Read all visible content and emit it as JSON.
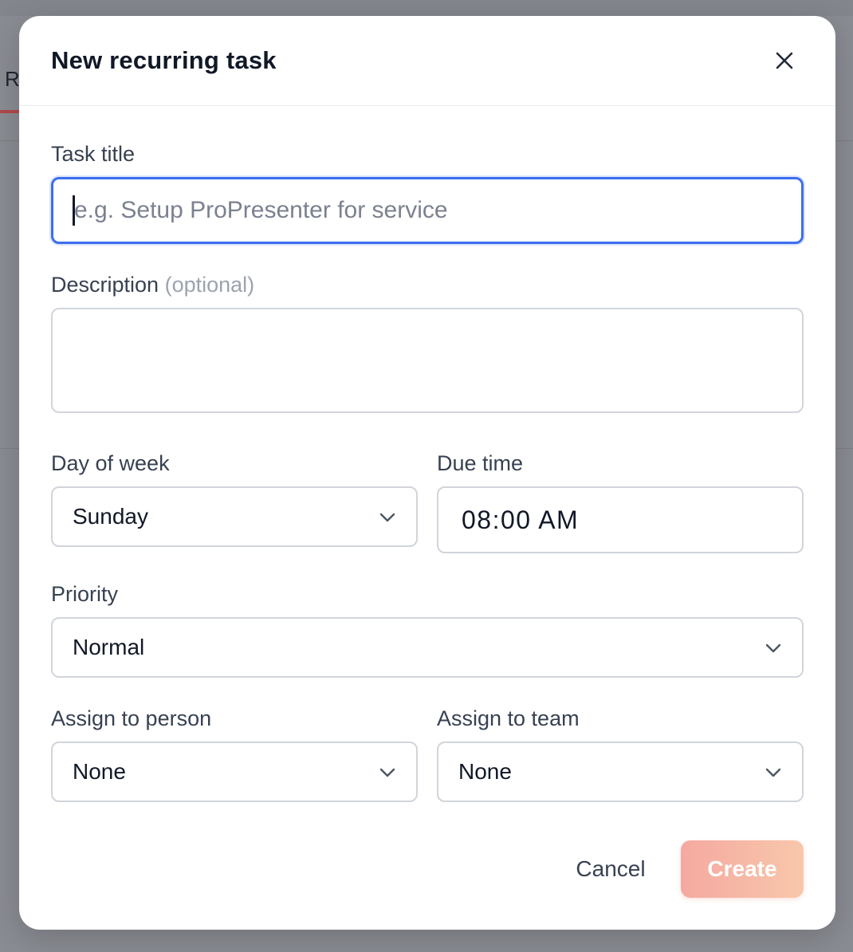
{
  "background": {
    "tab_letter": "R"
  },
  "modal": {
    "title": "New recurring task",
    "close_icon": "close-icon"
  },
  "form": {
    "task_title": {
      "label": "Task title",
      "value": "",
      "placeholder": "e.g. Setup ProPresenter for service"
    },
    "description": {
      "label": "Description",
      "optional_text": "(optional)",
      "value": ""
    },
    "day_of_week": {
      "label": "Day of week",
      "value": "Sunday"
    },
    "due_time": {
      "label": "Due time",
      "value": "08:00 AM"
    },
    "priority": {
      "label": "Priority",
      "value": "Normal"
    },
    "assign_person": {
      "label": "Assign to person",
      "value": "None"
    },
    "assign_team": {
      "label": "Assign to team",
      "value": "None"
    }
  },
  "actions": {
    "cancel_label": "Cancel",
    "create_label": "Create"
  },
  "colors": {
    "focus_border": "#3b6ef0",
    "create_gradient_start": "#f5a9a1",
    "create_gradient_end": "#f8c7ab"
  }
}
